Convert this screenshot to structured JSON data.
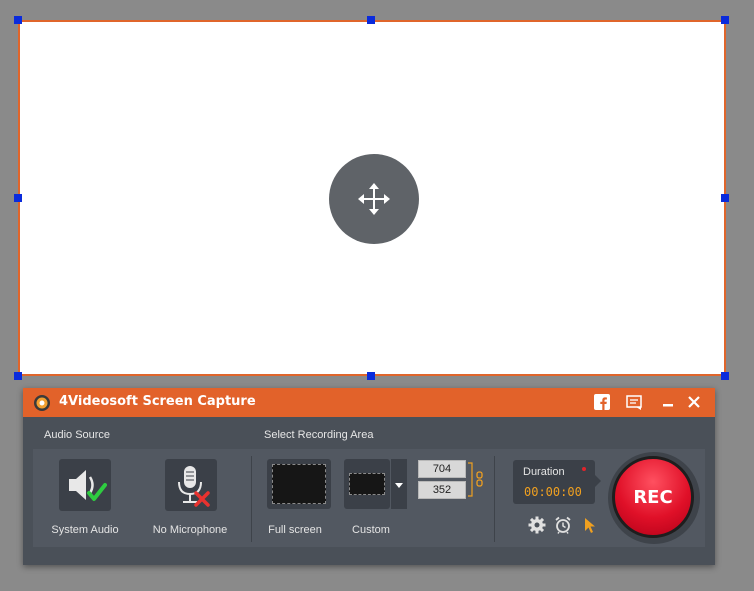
{
  "app": {
    "title": "4Videosoft Screen Capture"
  },
  "titlebar_icons": [
    "facebook-icon",
    "feedback-icon",
    "minimize-icon",
    "close-icon"
  ],
  "audio": {
    "section_label": "Audio Source",
    "system_audio_label": "System Audio",
    "microphone_label": "No Microphone",
    "system_audio_enabled": true,
    "microphone_enabled": false
  },
  "area": {
    "section_label": "Select Recording Area",
    "fullscreen_label": "Full screen",
    "custom_label": "Custom",
    "width": "704",
    "height": "352"
  },
  "recording": {
    "duration_label": "Duration",
    "duration_value": "00:00:00",
    "rec_label": "REC"
  },
  "colors": {
    "accent": "#e2622a",
    "handle": "#0a2bdc",
    "rec": "#e01028",
    "duration": "#f0a020"
  }
}
